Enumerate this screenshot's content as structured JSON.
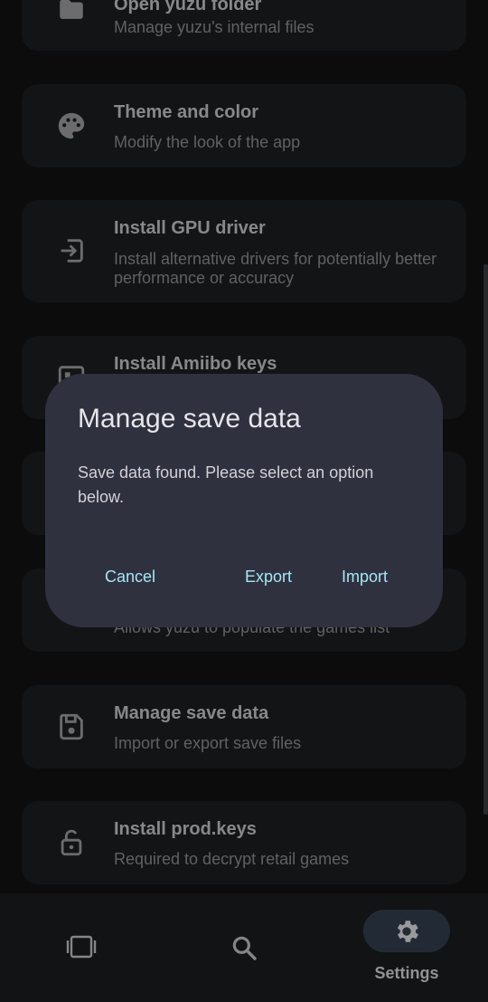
{
  "settings_list": [
    {
      "title": "Open yuzu folder",
      "subtitle": "Manage yuzu's internal files",
      "icon": "folder-icon"
    },
    {
      "title": "Theme and color",
      "subtitle": "Modify the look of the app",
      "icon": "palette-icon"
    },
    {
      "title": "Install GPU driver",
      "subtitle": "Install alternative drivers for potentially better performance or accuracy",
      "icon": "install-icon"
    },
    {
      "title": "Install Amiibo keys",
      "subtitle": "",
      "icon": "amiibo-icon"
    },
    {
      "title": "",
      "subtitle": "",
      "icon": ""
    },
    {
      "title": "",
      "subtitle": "Allows yuzu to populate the games list",
      "icon": ""
    },
    {
      "title": "Manage save data",
      "subtitle": "Import or export save files",
      "icon": "save-icon"
    },
    {
      "title": "Install prod.keys",
      "subtitle": "Required to decrypt retail games",
      "icon": "lock-open-icon"
    }
  ],
  "dialog": {
    "title": "Manage save data",
    "message": "Save data found. Please select an option below.",
    "cancel": "Cancel",
    "export": "Export",
    "import": "Import"
  },
  "bottom_nav": {
    "games_icon": "games-library-icon",
    "search_icon": "search-icon",
    "settings_icon": "gear-icon",
    "settings_label": "Settings"
  },
  "colors": {
    "background": "#121314",
    "card": "#1d1e20",
    "dialog": "#30313f",
    "accent": "#a5e6f4"
  }
}
